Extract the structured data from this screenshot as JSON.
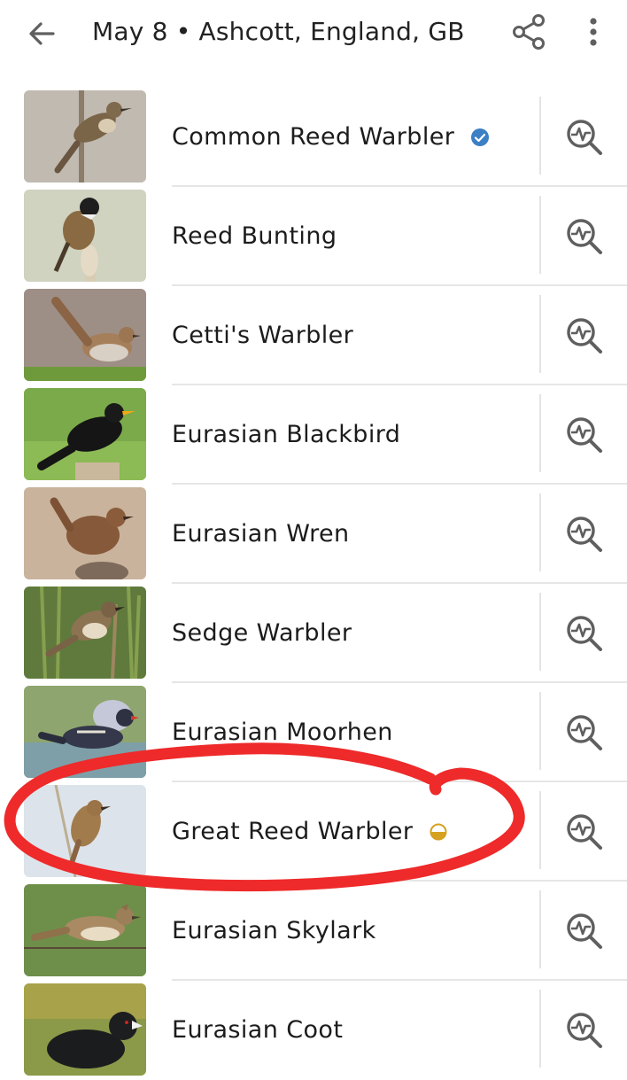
{
  "header": {
    "title": "May 8 • Ashcott, England, GB",
    "back_icon": "arrow-left-icon",
    "share_icon": "share-icon",
    "more_icon": "more-vert-icon"
  },
  "colors": {
    "verified_badge": "#3b7fc4",
    "uncertain_badge": "#d6a11e",
    "highlight_annotation": "#ee2a2a",
    "icon": "#5f5f5f"
  },
  "species": [
    {
      "name": "Common Reed Warbler",
      "badge": "verified-badge-icon"
    },
    {
      "name": "Reed Bunting",
      "badge": ""
    },
    {
      "name": "Cetti's Warbler",
      "badge": ""
    },
    {
      "name": "Eurasian Blackbird",
      "badge": ""
    },
    {
      "name": "Eurasian Wren",
      "badge": ""
    },
    {
      "name": "Sedge Warbler",
      "badge": ""
    },
    {
      "name": "Eurasian Moorhen",
      "badge": ""
    },
    {
      "name": "Great Reed Warbler",
      "badge": "uncertain-badge-icon",
      "highlighted": true
    },
    {
      "name": "Eurasian Skylark",
      "badge": ""
    },
    {
      "name": "Eurasian Coot",
      "badge": ""
    }
  ],
  "row_action_icon": "explore-species-icon"
}
